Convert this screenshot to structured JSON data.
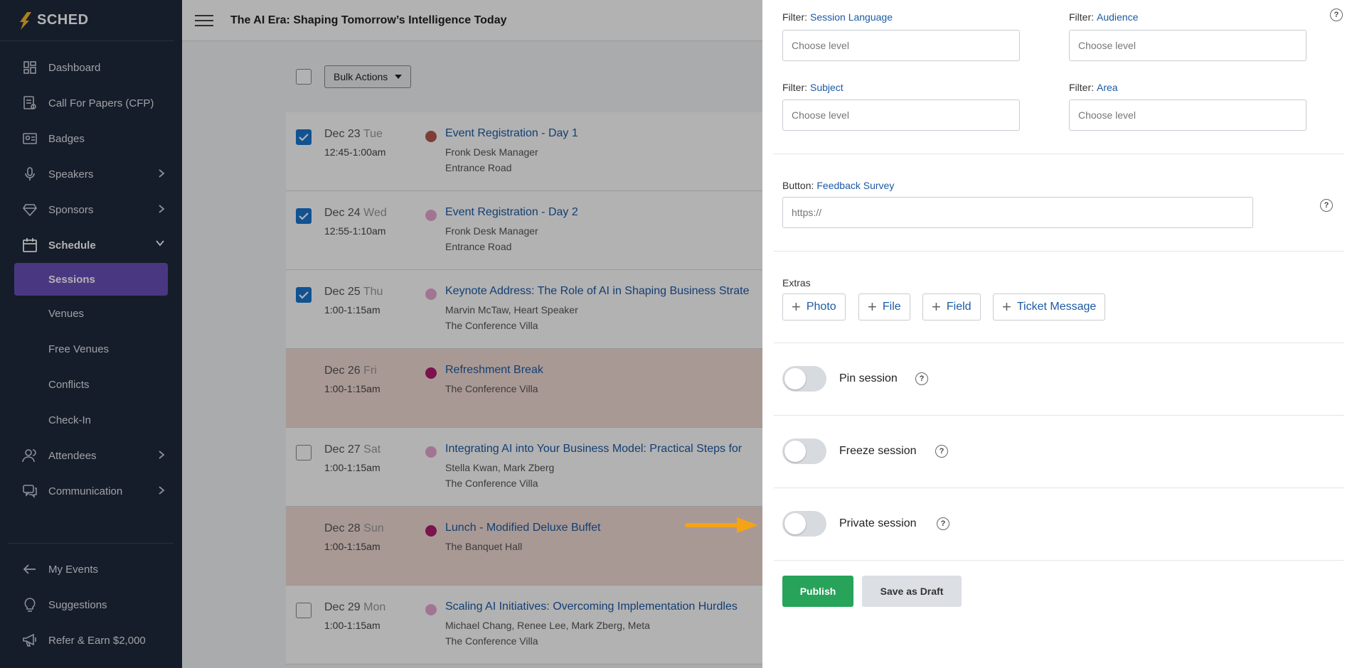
{
  "app": {
    "logo_text": "SCHED"
  },
  "sidebar": {
    "items": [
      {
        "label": "Dashboard",
        "icon": "dashboard-icon"
      },
      {
        "label": "Call For Papers (CFP)",
        "icon": "cfp-icon"
      },
      {
        "label": "Badges",
        "icon": "badge-icon"
      },
      {
        "label": "Speakers",
        "icon": "microphone-icon"
      },
      {
        "label": "Sponsors",
        "icon": "diamond-icon"
      },
      {
        "label": "Schedule",
        "icon": "calendar-icon"
      }
    ],
    "schedule_sub": [
      "Sessions",
      "Venues",
      "Free Venues",
      "Conflicts",
      "Check-In"
    ],
    "more_items": [
      {
        "label": "Attendees",
        "icon": "users-icon"
      },
      {
        "label": "Communication",
        "icon": "chat-icon"
      }
    ],
    "bottom_items": [
      {
        "label": "My Events",
        "icon": "arrow-left-icon"
      },
      {
        "label": "Suggestions",
        "icon": "lightbulb-icon"
      },
      {
        "label": "Refer & Earn $2,000",
        "icon": "megaphone-icon"
      }
    ]
  },
  "header": {
    "title": "The AI Era: Shaping Tomorrow’s Intelligence Today"
  },
  "toolbar": {
    "bulk_actions": "Bulk Actions"
  },
  "sessions": [
    {
      "date": "Dec 23",
      "dow": "Tue",
      "time": "12:45-1:00am",
      "title": "Event Registration - Day 1",
      "line1": "Fronk Desk Manager",
      "line2": "Entrance Road",
      "checked": true,
      "dot": "#b5584f",
      "tint": false
    },
    {
      "date": "Dec 24",
      "dow": "Wed",
      "time": "12:55-1:10am",
      "title": "Event Registration - Day 2",
      "line1": "Fronk Desk Manager",
      "line2": "Entrance Road",
      "checked": true,
      "dot": "#e7a8d1",
      "tint": false
    },
    {
      "date": "Dec 25",
      "dow": "Thu",
      "time": "1:00-1:15am",
      "title": "Keynote Address: The Role of AI in Shaping Business Strate",
      "line1": "Marvin McTaw, Heart Speaker",
      "line2": "The Conference Villa",
      "checked": true,
      "dot": "#e7a8d1",
      "tint": false
    },
    {
      "date": "Dec 26",
      "dow": "Fri",
      "time": "1:00-1:15am",
      "title": "Refreshment Break",
      "line1": "The Conference Villa",
      "line2": "",
      "checked": false,
      "dot": "#b01e6e",
      "tint": true
    },
    {
      "date": "Dec 27",
      "dow": "Sat",
      "time": "1:00-1:15am",
      "title": "Integrating AI into Your Business Model: Practical Steps for",
      "line1": "Stella Kwan, Mark Zberg",
      "line2": "The Conference Villa",
      "checked": false,
      "dot": "#e7a8d1",
      "tint": false
    },
    {
      "date": "Dec 28",
      "dow": "Sun",
      "time": "1:00-1:15am",
      "title": "Lunch - Modified Deluxe Buffet",
      "line1": "The Banquet Hall",
      "line2": "",
      "checked": false,
      "dot": "#b01e6e",
      "tint": true
    },
    {
      "date": "Dec 29",
      "dow": "Mon",
      "time": "1:00-1:15am",
      "title": "Scaling AI Initiatives: Overcoming Implementation Hurdles",
      "line1": "Michael Chang, Renee Lee, Mark Zberg, Meta",
      "line2": "The Conference Villa",
      "checked": false,
      "dot": "#e7a8d1",
      "tint": false
    }
  ],
  "panel": {
    "filters": [
      {
        "label": "Filter:",
        "value": "Session Language",
        "placeholder": "Choose level"
      },
      {
        "label": "Filter:",
        "value": "Audience",
        "placeholder": "Choose level"
      },
      {
        "label": "Filter:",
        "value": "Subject",
        "placeholder": "Choose level"
      },
      {
        "label": "Filter:",
        "value": "Area",
        "placeholder": "Choose level"
      }
    ],
    "button_label": "Button:",
    "button_value": "Feedback Survey",
    "button_placeholder": "https://",
    "extras_label": "Extras",
    "extras": [
      "Photo",
      "File",
      "Field",
      "Ticket Message"
    ],
    "toggles": [
      {
        "label": "Pin session",
        "on": false
      },
      {
        "label": "Freeze session",
        "on": false
      },
      {
        "label": "Private session",
        "on": false
      }
    ],
    "help_glyph": "?",
    "publish": "Publish",
    "save_draft": "Save as Draft"
  }
}
